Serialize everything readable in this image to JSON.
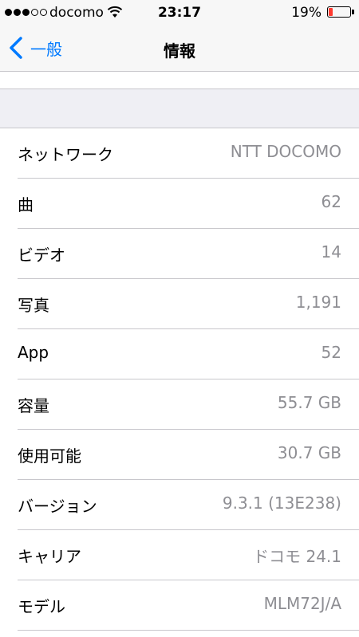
{
  "status_bar": {
    "carrier": "docomo",
    "time": "23:17",
    "battery_percent": "19%",
    "battery_level": 0.19,
    "battery_color": "#ff3b30",
    "signal_bars_filled": 3,
    "signal_bars_total": 5
  },
  "nav": {
    "back_label": "一般",
    "title": "情報",
    "accent_color": "#007aff"
  },
  "rows": [
    {
      "label": "ネットワーク",
      "value": "NTT DOCOMO"
    },
    {
      "label": "曲",
      "value": "62"
    },
    {
      "label": "ビデオ",
      "value": "14"
    },
    {
      "label": "写真",
      "value": "1,191"
    },
    {
      "label": "App",
      "value": "52"
    },
    {
      "label": "容量",
      "value": "55.7 GB"
    },
    {
      "label": "使用可能",
      "value": "30.7 GB"
    },
    {
      "label": "バージョン",
      "value": "9.3.1 (13E238)"
    },
    {
      "label": "キャリア",
      "value": "ドコモ 24.1"
    },
    {
      "label": "モデル",
      "value": "MLM72J/A"
    }
  ]
}
